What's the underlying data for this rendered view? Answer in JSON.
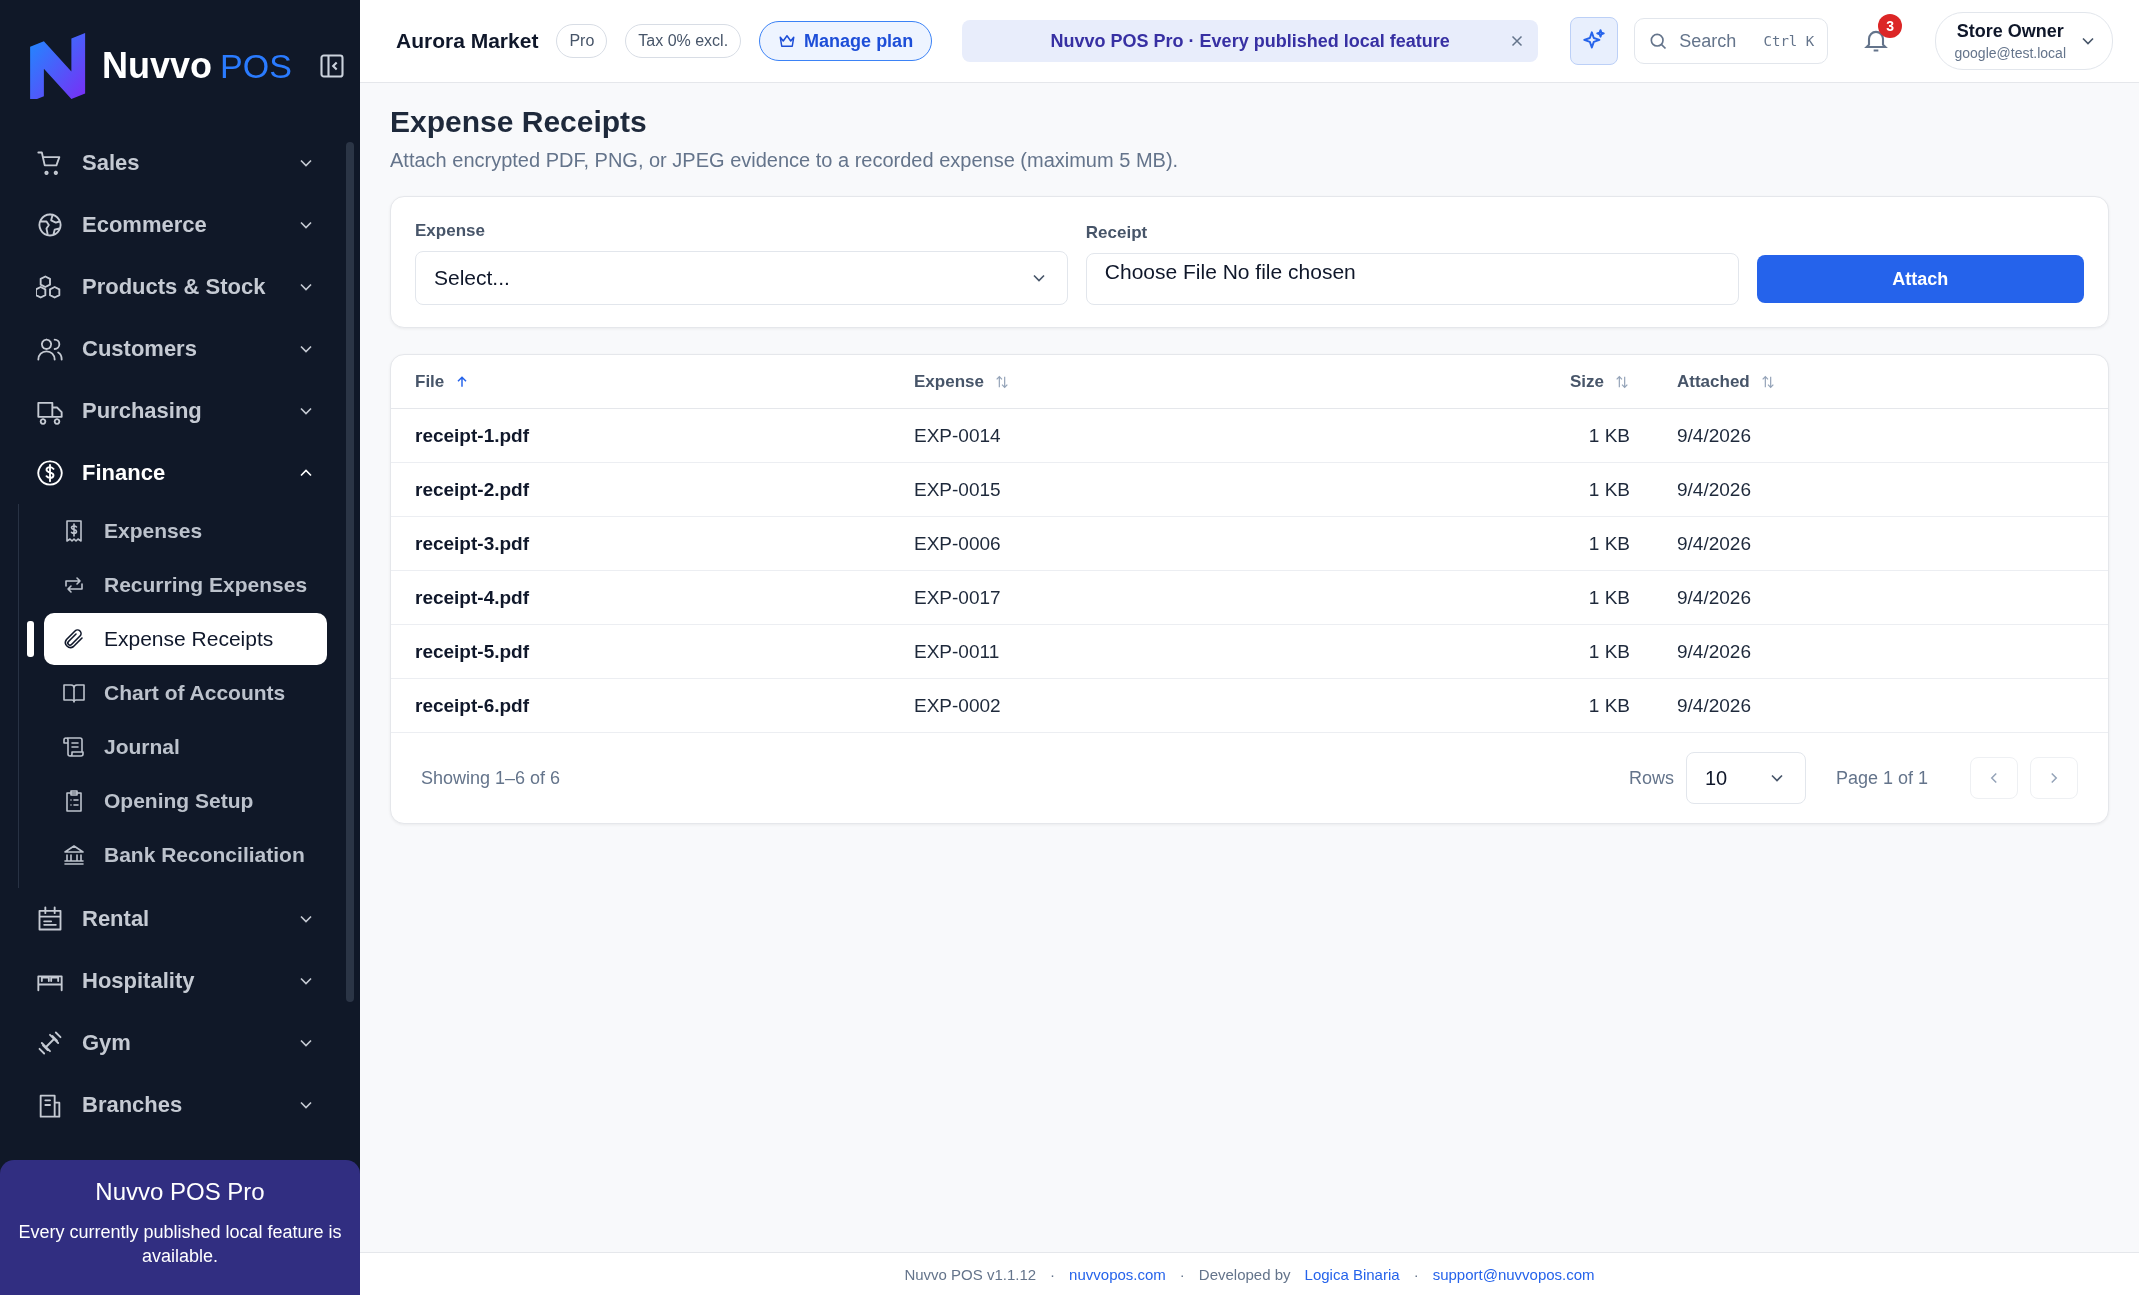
{
  "brand": {
    "name": "Nuvvo",
    "suffix": "POS"
  },
  "sidebar": {
    "items": [
      {
        "label": "Sales",
        "expanded": false
      },
      {
        "label": "Ecommerce",
        "expanded": false
      },
      {
        "label": "Products & Stock",
        "expanded": false
      },
      {
        "label": "Customers",
        "expanded": false
      },
      {
        "label": "Purchasing",
        "expanded": false
      },
      {
        "label": "Finance",
        "expanded": true,
        "children": [
          {
            "label": "Expenses",
            "selected": false
          },
          {
            "label": "Recurring Expenses",
            "selected": false
          },
          {
            "label": "Expense Receipts",
            "selected": true
          },
          {
            "label": "Chart of Accounts",
            "selected": false
          },
          {
            "label": "Journal",
            "selected": false
          },
          {
            "label": "Opening Setup",
            "selected": false
          },
          {
            "label": "Bank Reconciliation",
            "selected": false
          }
        ]
      },
      {
        "label": "Rental",
        "expanded": false
      },
      {
        "label": "Hospitality",
        "expanded": false
      },
      {
        "label": "Gym",
        "expanded": false
      },
      {
        "label": "Branches",
        "expanded": false
      }
    ],
    "promo": {
      "title": "Nuvvo POS Pro",
      "text": "Every currently published local feature is available."
    }
  },
  "header": {
    "store": "Aurora Market",
    "badges": [
      "Pro",
      "Tax 0% excl."
    ],
    "plan_button": "Manage plan",
    "banner": "Nuvvo POS Pro · Every published local feature",
    "search": {
      "placeholder": "Search",
      "shortcut": "Ctrl K"
    },
    "notifications": "3",
    "user": {
      "name": "Store Owner",
      "email": "google@test.local"
    }
  },
  "page": {
    "title": "Expense Receipts",
    "subtitle": "Attach encrypted PDF, PNG, or JPEG evidence to a recorded expense (maximum 5 MB)."
  },
  "form": {
    "expense": {
      "label": "Expense",
      "value": "Select..."
    },
    "receipt": {
      "label": "Receipt",
      "button": "Choose File",
      "status": "No file chosen"
    },
    "submit": "Attach"
  },
  "table": {
    "columns": [
      {
        "label": "File",
        "sorted": true
      },
      {
        "label": "Expense",
        "sorted": false
      },
      {
        "label": "Size",
        "sorted": false
      },
      {
        "label": "Attached",
        "sorted": false
      }
    ],
    "rows": [
      {
        "file": "receipt-1.pdf",
        "expense": "EXP-0014",
        "size": "1 KB",
        "attached": "9/4/2026"
      },
      {
        "file": "receipt-2.pdf",
        "expense": "EXP-0015",
        "size": "1 KB",
        "attached": "9/4/2026"
      },
      {
        "file": "receipt-3.pdf",
        "expense": "EXP-0006",
        "size": "1 KB",
        "attached": "9/4/2026"
      },
      {
        "file": "receipt-4.pdf",
        "expense": "EXP-0017",
        "size": "1 KB",
        "attached": "9/4/2026"
      },
      {
        "file": "receipt-5.pdf",
        "expense": "EXP-0011",
        "size": "1 KB",
        "attached": "9/4/2026"
      },
      {
        "file": "receipt-6.pdf",
        "expense": "EXP-0002",
        "size": "1 KB",
        "attached": "9/4/2026"
      }
    ]
  },
  "pagination": {
    "summary": "Showing 1–6 of 6",
    "rows_label": "Rows",
    "rows_value": "10",
    "page": "Page 1 of 1"
  },
  "footer": [
    {
      "kind": "text",
      "text": "Nuvvo POS v1.1.12"
    },
    {
      "kind": "separator",
      "text": "·"
    },
    {
      "kind": "link",
      "text": "nuvvopos.com"
    },
    {
      "kind": "separator",
      "text": "·"
    },
    {
      "kind": "text",
      "text": "Developed by"
    },
    {
      "kind": "link",
      "text": "Logica Binaria"
    },
    {
      "kind": "separator",
      "text": "·"
    },
    {
      "kind": "link",
      "text": "support@nuvvopos.com"
    }
  ]
}
